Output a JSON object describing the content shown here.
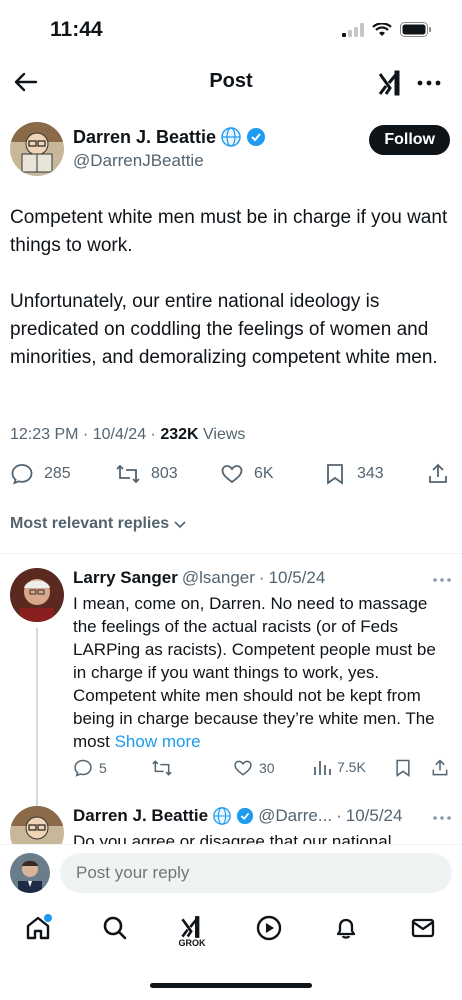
{
  "status_bar": {
    "time": "11:44"
  },
  "header": {
    "title": "Post"
  },
  "post": {
    "author_name": "Darren J. Beattie",
    "author_handle": "@DarrenJBeattie",
    "follow_label": "Follow",
    "text": "Competent white men must be in charge if you want things to work.\n\nUnfortunately, our entire national ideology is predicated on coddling the feelings of women and minorities, and demoralizing competent white men.",
    "time": "12:23 PM",
    "date": "10/4/24",
    "views_count": "232K",
    "views_label": "Views",
    "stats": {
      "replies": "285",
      "reposts": "803",
      "likes": "6K",
      "bookmarks": "343"
    }
  },
  "replies_filter": {
    "label": "Most relevant replies"
  },
  "replies": [
    {
      "name": "Larry Sanger",
      "handle": "@lsanger",
      "date": "10/5/24",
      "text": "I mean, come on, Darren. No need to massage the feelings of the actual racists (or of Feds LARPing as racists). Competent people must be in charge if you want things to work, yes. Competent white men should not be kept from being in charge because they’re white men. The most",
      "show_more": "Show more",
      "stats": {
        "replies": "5",
        "reposts": "",
        "likes": "30",
        "views": "7.5K"
      }
    },
    {
      "name": "Darren J. Beattie",
      "handle": "@Darre...",
      "date": "10/5/24",
      "text": "Do you agree or disagree that our national"
    }
  ],
  "composer": {
    "placeholder": "Post your reply"
  },
  "tabbar": {
    "grok_label": "GROK"
  },
  "colors": {
    "accent": "#1d9bf0",
    "verified": "#1d9bf0",
    "text": "#0f1419",
    "muted": "#536471"
  }
}
